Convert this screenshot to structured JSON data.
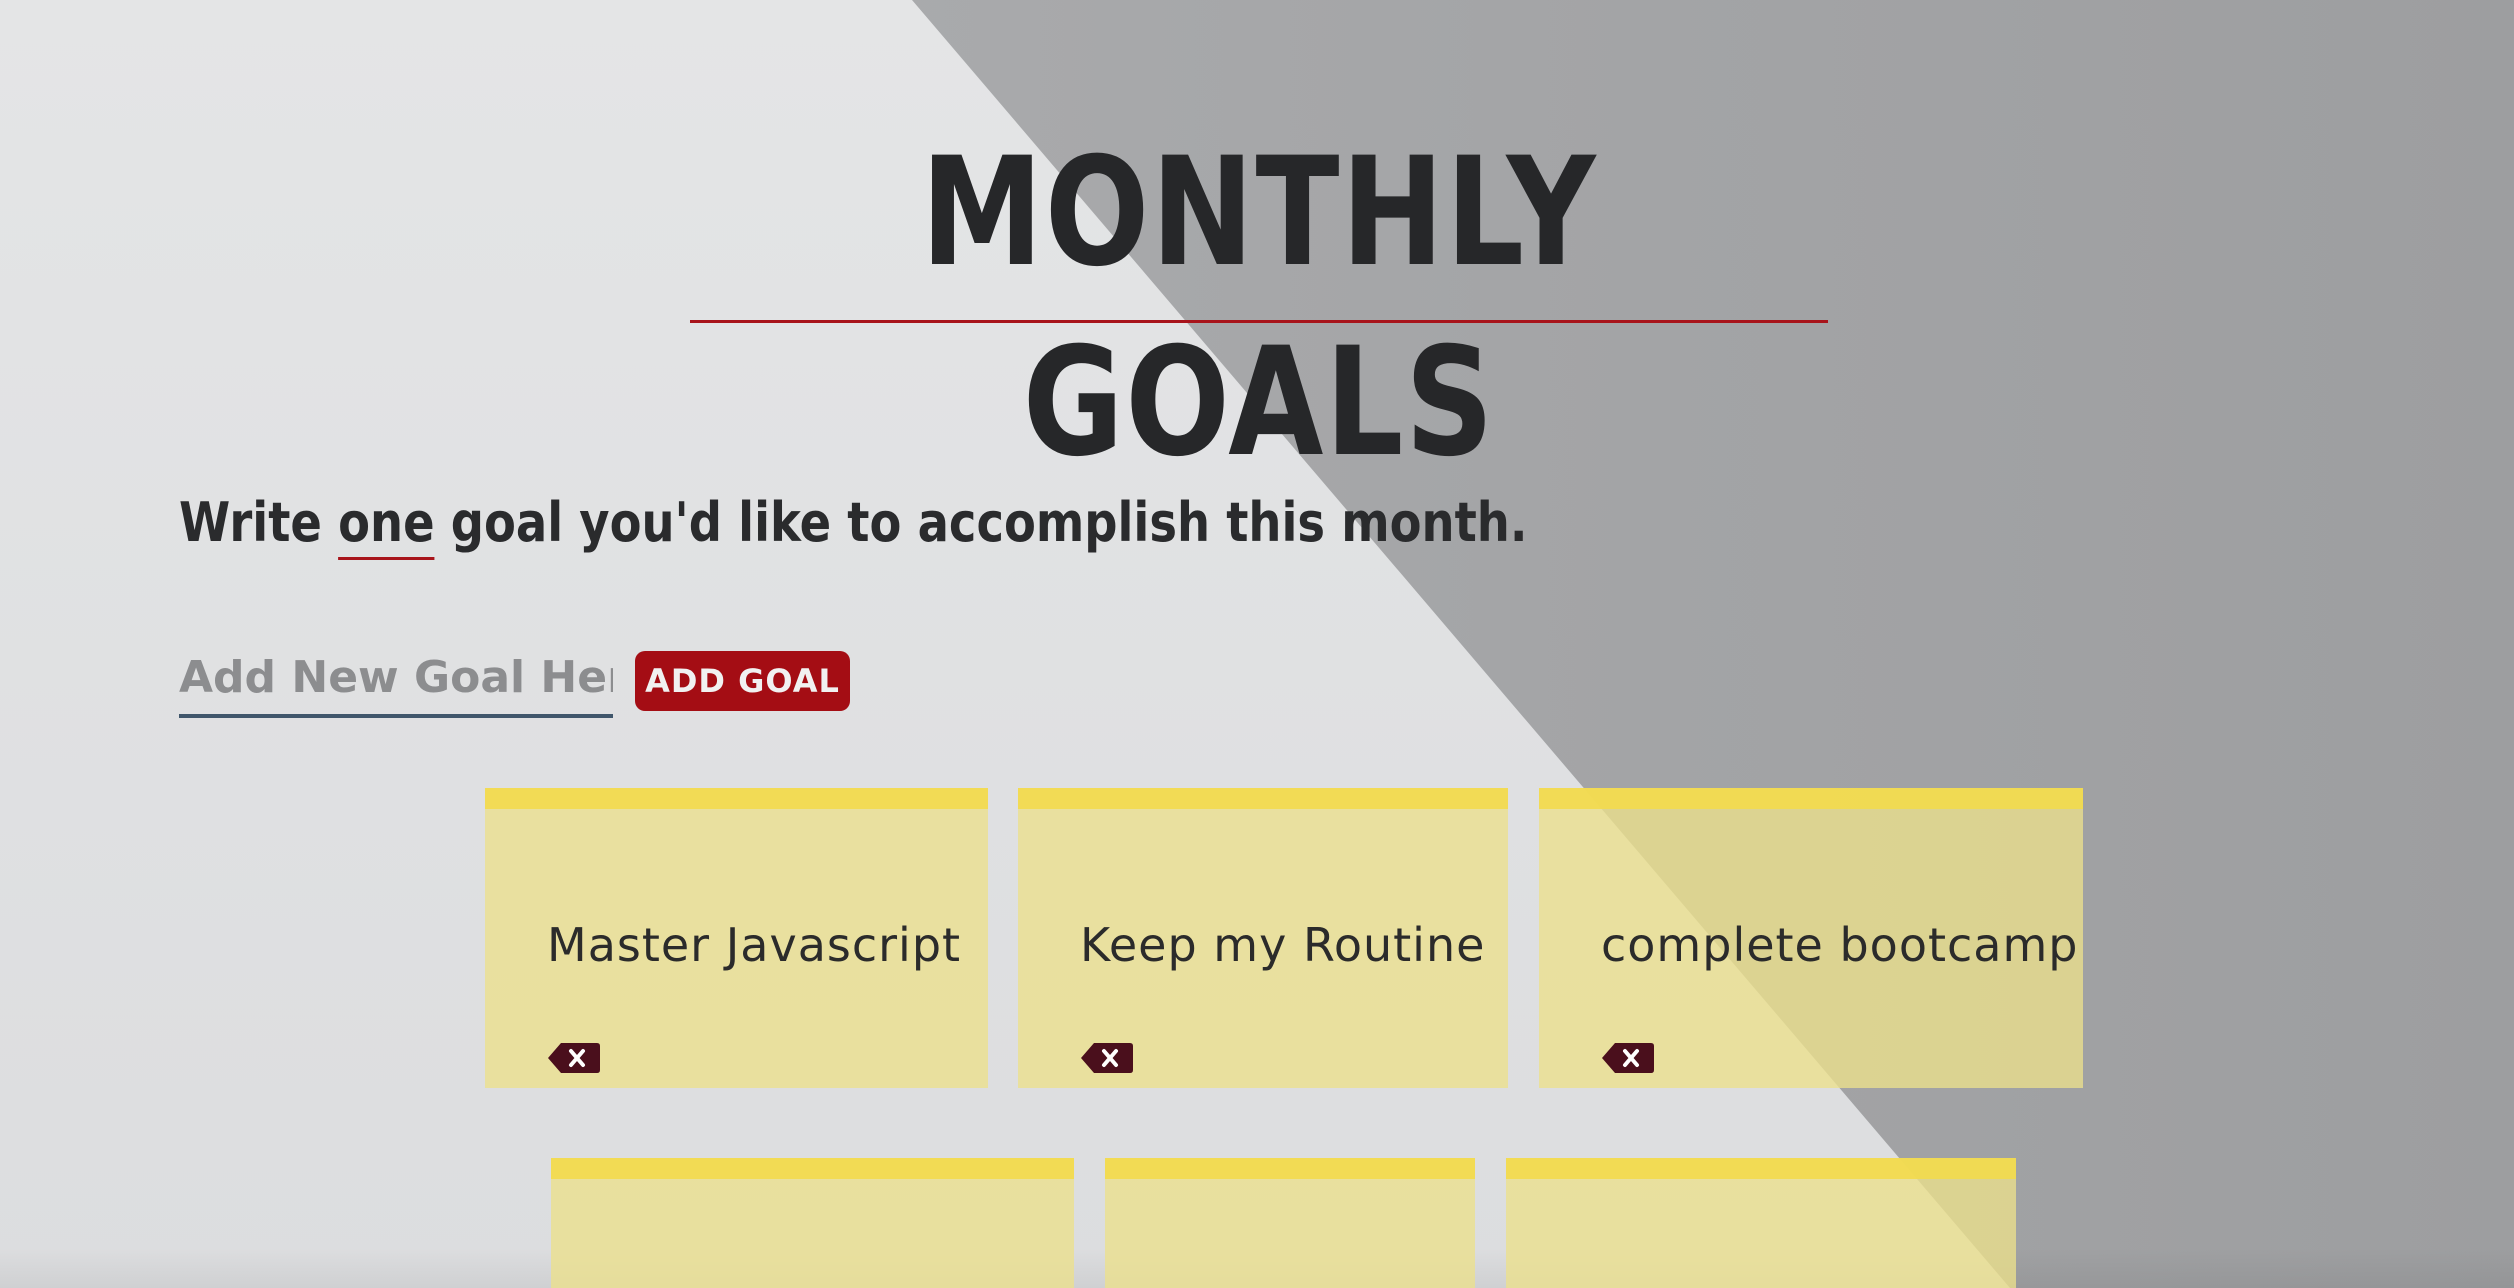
{
  "page": {
    "title": "MONTHLY GOALS",
    "prompt": {
      "before": "Write ",
      "emphasis": "one",
      "after": " goal you'd like to accomplish this month."
    }
  },
  "form": {
    "input_value": "",
    "input_placeholder": "Add New Goal Here",
    "button_label": "ADD GOAL"
  },
  "goals": [
    {
      "text": "Master Javascript",
      "delete_icon": "backspace-x-icon"
    },
    {
      "text": "Keep my Routine",
      "delete_icon": "backspace-x-icon"
    },
    {
      "text": "complete bootcamp",
      "delete_icon": "backspace-x-icon"
    },
    {
      "text": ""
    },
    {
      "text": ""
    },
    {
      "text": ""
    }
  ],
  "colors": {
    "accent_red": "#a40d14",
    "note_yellow": "#ece08c",
    "tape_yellow": "#f2da4e",
    "title_text": "#262729",
    "delete_icon": "#4a0f1c"
  }
}
